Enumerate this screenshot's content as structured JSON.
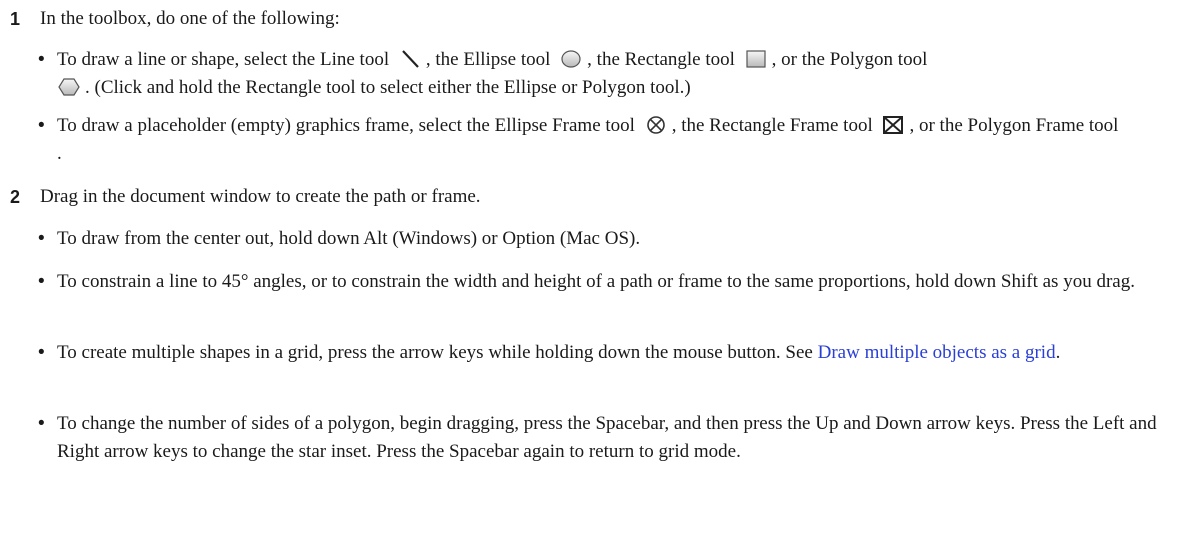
{
  "step1": {
    "number": "1",
    "text": "In the toolbox, do one of the following:",
    "bullet_a": {
      "t1": "To draw a line or shape, select the Line tool",
      "t2": ", the Ellipse tool",
      "t3": ", the Rectangle tool",
      "t4": ", or the Polygon tool",
      "t5": ". (Click and hold the Rectangle tool to select either the Ellipse or Polygon tool.)"
    },
    "bullet_b": {
      "t1": "To draw a placeholder (empty) graphics frame, select the Ellipse Frame tool",
      "t2": ", the Rectangle Frame tool",
      "t3": ", or the Polygon Frame tool",
      "t4": "."
    }
  },
  "step2": {
    "number": "2",
    "text": "Drag in the document window to create the path or frame.",
    "bullets": [
      "To draw from the center out, hold down Alt (Windows) or Option (Mac OS).",
      "To constrain a line to 45° angles, or to constrain the width and height of a path or frame to the same proportions, hold down Shift as you drag.",
      "To change the number of sides of a polygon, begin dragging, press the Spacebar, and then press the Up and Down arrow keys. Press the Left and Right arrow keys to change the star inset. Press the Spacebar again to return to grid mode."
    ],
    "grid_bullet": {
      "text": "To create multiple shapes in a grid, press the arrow keys while holding down the mouse button. See ",
      "link": "Draw multiple objects as a grid",
      "end": "."
    }
  },
  "bullet_char": "•",
  "icons": [
    "line-tool-icon",
    "ellipse-tool-icon",
    "rectangle-tool-icon",
    "polygon-tool-icon",
    "ellipse-frame-tool-icon",
    "rectangle-frame-tool-icon",
    "polygon-frame-tool-icon"
  ],
  "link_color": "#2a3fd6"
}
